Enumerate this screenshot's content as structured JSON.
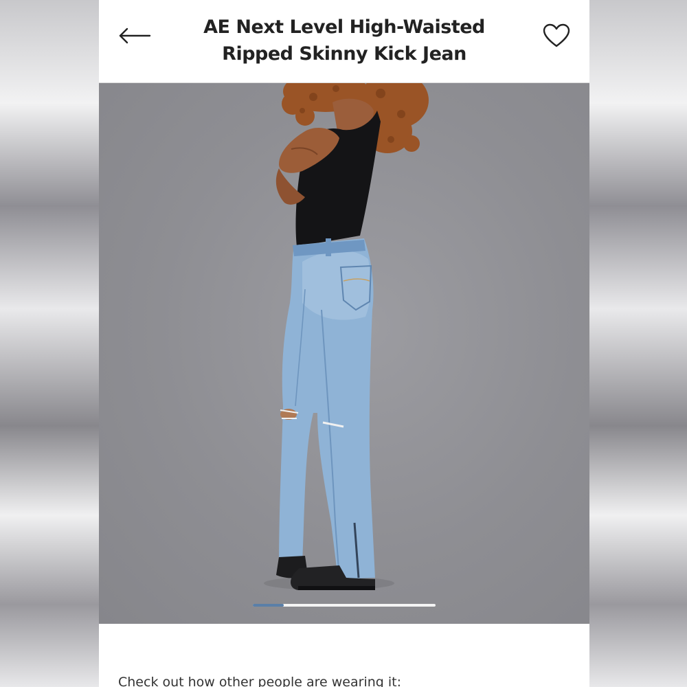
{
  "header": {
    "title": "AE Next Level High-Waisted Ripped Skinny Kick Jean",
    "back_icon": "arrow-left-icon",
    "favorite_icon": "heart-outline-icon"
  },
  "gallery": {
    "image_description": "model-wearing-jeans",
    "carousel_progress": 0.17,
    "accent_color": "#5a7fa8"
  },
  "social": {
    "prompt": "Check out how other people are wearing it:"
  }
}
